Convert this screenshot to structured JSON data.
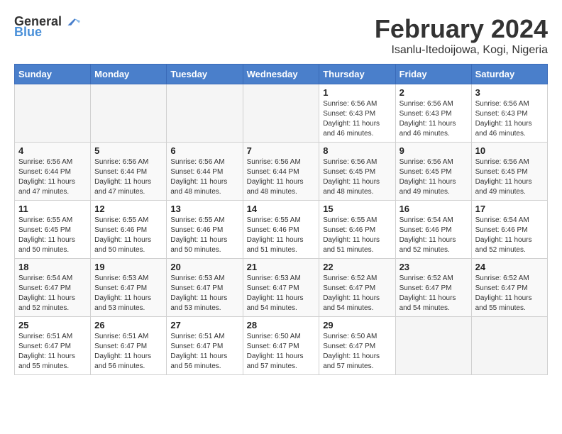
{
  "logo": {
    "general": "General",
    "blue": "Blue"
  },
  "title": "February 2024",
  "location": "Isanlu-Itedoijowa, Kogi, Nigeria",
  "headers": [
    "Sunday",
    "Monday",
    "Tuesday",
    "Wednesday",
    "Thursday",
    "Friday",
    "Saturday"
  ],
  "weeks": [
    [
      {
        "day": "",
        "detail": ""
      },
      {
        "day": "",
        "detail": ""
      },
      {
        "day": "",
        "detail": ""
      },
      {
        "day": "",
        "detail": ""
      },
      {
        "day": "1",
        "detail": "Sunrise: 6:56 AM\nSunset: 6:43 PM\nDaylight: 11 hours\nand 46 minutes."
      },
      {
        "day": "2",
        "detail": "Sunrise: 6:56 AM\nSunset: 6:43 PM\nDaylight: 11 hours\nand 46 minutes."
      },
      {
        "day": "3",
        "detail": "Sunrise: 6:56 AM\nSunset: 6:43 PM\nDaylight: 11 hours\nand 46 minutes."
      }
    ],
    [
      {
        "day": "4",
        "detail": "Sunrise: 6:56 AM\nSunset: 6:44 PM\nDaylight: 11 hours\nand 47 minutes."
      },
      {
        "day": "5",
        "detail": "Sunrise: 6:56 AM\nSunset: 6:44 PM\nDaylight: 11 hours\nand 47 minutes."
      },
      {
        "day": "6",
        "detail": "Sunrise: 6:56 AM\nSunset: 6:44 PM\nDaylight: 11 hours\nand 48 minutes."
      },
      {
        "day": "7",
        "detail": "Sunrise: 6:56 AM\nSunset: 6:44 PM\nDaylight: 11 hours\nand 48 minutes."
      },
      {
        "day": "8",
        "detail": "Sunrise: 6:56 AM\nSunset: 6:45 PM\nDaylight: 11 hours\nand 48 minutes."
      },
      {
        "day": "9",
        "detail": "Sunrise: 6:56 AM\nSunset: 6:45 PM\nDaylight: 11 hours\nand 49 minutes."
      },
      {
        "day": "10",
        "detail": "Sunrise: 6:56 AM\nSunset: 6:45 PM\nDaylight: 11 hours\nand 49 minutes."
      }
    ],
    [
      {
        "day": "11",
        "detail": "Sunrise: 6:55 AM\nSunset: 6:45 PM\nDaylight: 11 hours\nand 50 minutes."
      },
      {
        "day": "12",
        "detail": "Sunrise: 6:55 AM\nSunset: 6:46 PM\nDaylight: 11 hours\nand 50 minutes."
      },
      {
        "day": "13",
        "detail": "Sunrise: 6:55 AM\nSunset: 6:46 PM\nDaylight: 11 hours\nand 50 minutes."
      },
      {
        "day": "14",
        "detail": "Sunrise: 6:55 AM\nSunset: 6:46 PM\nDaylight: 11 hours\nand 51 minutes."
      },
      {
        "day": "15",
        "detail": "Sunrise: 6:55 AM\nSunset: 6:46 PM\nDaylight: 11 hours\nand 51 minutes."
      },
      {
        "day": "16",
        "detail": "Sunrise: 6:54 AM\nSunset: 6:46 PM\nDaylight: 11 hours\nand 52 minutes."
      },
      {
        "day": "17",
        "detail": "Sunrise: 6:54 AM\nSunset: 6:46 PM\nDaylight: 11 hours\nand 52 minutes."
      }
    ],
    [
      {
        "day": "18",
        "detail": "Sunrise: 6:54 AM\nSunset: 6:47 PM\nDaylight: 11 hours\nand 52 minutes."
      },
      {
        "day": "19",
        "detail": "Sunrise: 6:53 AM\nSunset: 6:47 PM\nDaylight: 11 hours\nand 53 minutes."
      },
      {
        "day": "20",
        "detail": "Sunrise: 6:53 AM\nSunset: 6:47 PM\nDaylight: 11 hours\nand 53 minutes."
      },
      {
        "day": "21",
        "detail": "Sunrise: 6:53 AM\nSunset: 6:47 PM\nDaylight: 11 hours\nand 54 minutes."
      },
      {
        "day": "22",
        "detail": "Sunrise: 6:52 AM\nSunset: 6:47 PM\nDaylight: 11 hours\nand 54 minutes."
      },
      {
        "day": "23",
        "detail": "Sunrise: 6:52 AM\nSunset: 6:47 PM\nDaylight: 11 hours\nand 54 minutes."
      },
      {
        "day": "24",
        "detail": "Sunrise: 6:52 AM\nSunset: 6:47 PM\nDaylight: 11 hours\nand 55 minutes."
      }
    ],
    [
      {
        "day": "25",
        "detail": "Sunrise: 6:51 AM\nSunset: 6:47 PM\nDaylight: 11 hours\nand 55 minutes."
      },
      {
        "day": "26",
        "detail": "Sunrise: 6:51 AM\nSunset: 6:47 PM\nDaylight: 11 hours\nand 56 minutes."
      },
      {
        "day": "27",
        "detail": "Sunrise: 6:51 AM\nSunset: 6:47 PM\nDaylight: 11 hours\nand 56 minutes."
      },
      {
        "day": "28",
        "detail": "Sunrise: 6:50 AM\nSunset: 6:47 PM\nDaylight: 11 hours\nand 57 minutes."
      },
      {
        "day": "29",
        "detail": "Sunrise: 6:50 AM\nSunset: 6:47 PM\nDaylight: 11 hours\nand 57 minutes."
      },
      {
        "day": "",
        "detail": ""
      },
      {
        "day": "",
        "detail": ""
      }
    ]
  ]
}
